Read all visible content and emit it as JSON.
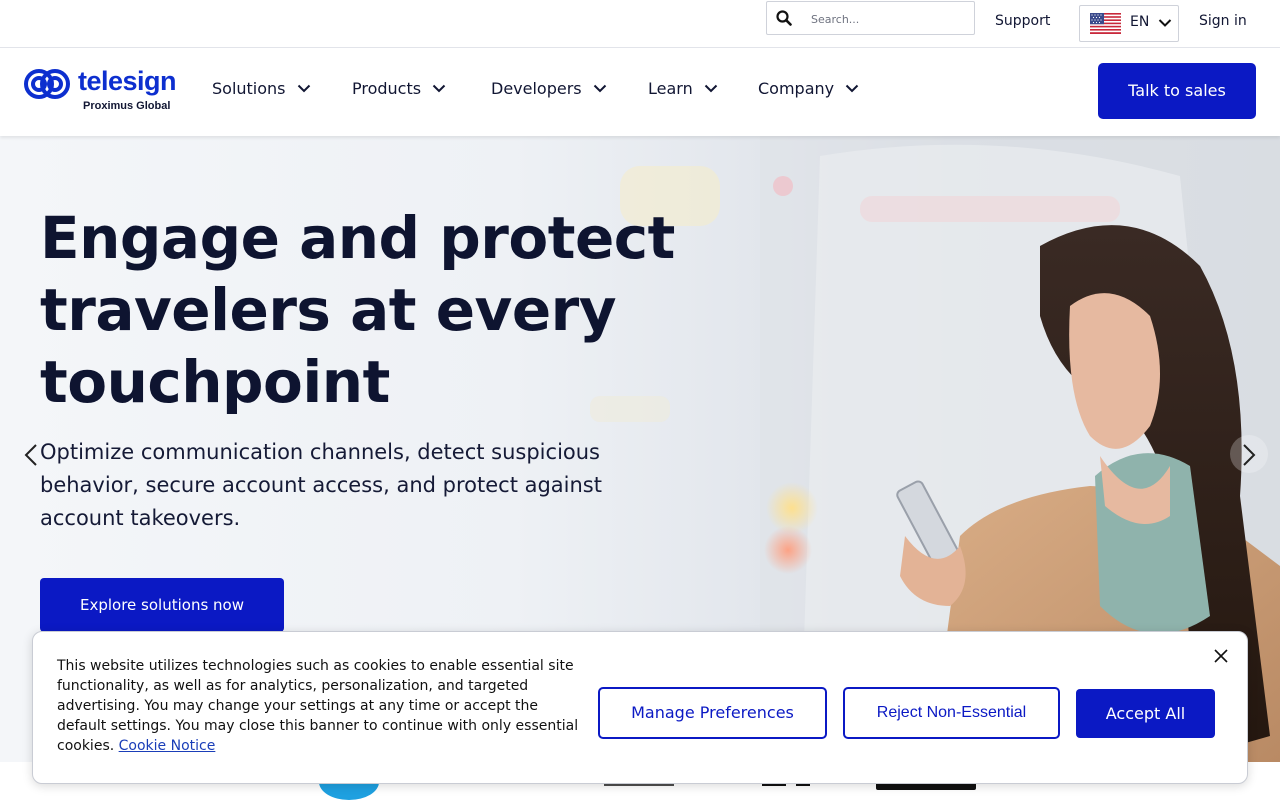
{
  "utility_bar": {
    "search_placeholder": "Search...",
    "support_label": "Support",
    "language_code": "EN",
    "signin_label": "Sign in"
  },
  "nav": {
    "logo_text": "telesign",
    "logo_subtext": "Proximus Global",
    "items": [
      {
        "label": "Solutions"
      },
      {
        "label": "Products"
      },
      {
        "label": "Developers"
      },
      {
        "label": "Learn"
      },
      {
        "label": "Company"
      }
    ],
    "cta_label": "Talk to sales"
  },
  "hero": {
    "title_line1": "Engage and protect",
    "title_line2": "travelers at every",
    "title_line3": "touchpoint",
    "subtitle": "Optimize communication channels, detect suspicious behavior, secure account access, and protect against account takeovers.",
    "cta_label": "Explore solutions now"
  },
  "cookie_banner": {
    "text": "This website utilizes technologies such as cookies to enable essential site functionality, as well as for analytics, personalization, and targeted advertising. You may change your settings at any time or accept the default settings. You may close this banner to continue with only essential cookies.",
    "link_label": "Cookie Notice",
    "manage_label": "Manage Preferences",
    "reject_label": "Reject Non-Essential",
    "accept_label": "Accept All"
  },
  "colors": {
    "brand": "#0b19c4",
    "heading": "#0e1430"
  }
}
